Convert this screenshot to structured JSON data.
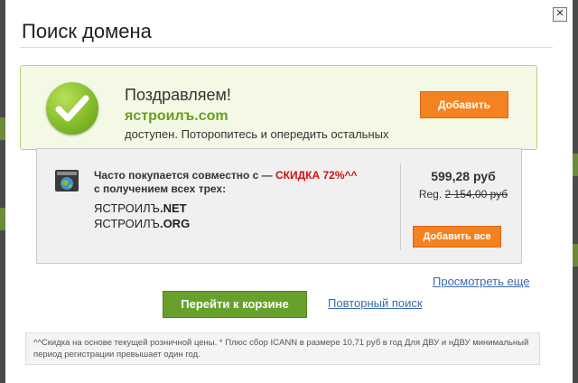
{
  "dialog": {
    "title": "Поиск домена",
    "close_icon": "close-icon"
  },
  "success": {
    "icon": "checkmark-icon",
    "congrats": "Поздравляем!",
    "domain": "ястроилъ.com",
    "availability": "доступен. Поторопитесь и опередить остальных",
    "add_button": "Добавить"
  },
  "bundle": {
    "icon": "domain-globe-icon",
    "text_before": "Часто покупается совместно с  — ",
    "discount": "СКИДКА 72%^^",
    "text_after": "  с получением всех трех:",
    "domains": [
      {
        "name": "ЯСТРОИЛЪ",
        "tld": ".NET"
      },
      {
        "name": "ЯСТРОИЛЪ",
        "tld": ".ORG"
      }
    ],
    "price": "599,28 руб",
    "reg_label": "Reg.",
    "reg_price": "2 154,00 руб",
    "add_all_button": "Добавить все"
  },
  "actions": {
    "view_more": "Просмотреть еще",
    "go_to_cart": "Перейти к корзине",
    "repeat_search": "Повторный поиск"
  },
  "footnote": "^^Скидка на основе текущей розничной цены. * Плюс сбор ICANN в размере 10,71 руб в год Для ДВУ и нДВУ минимальный период регистрации превышает один год.",
  "colors": {
    "accent_orange": "#f58220",
    "accent_green": "#67a12b",
    "domain_green": "#68a01f",
    "discount_red": "#cc1111",
    "link_blue": "#3b6ab0"
  }
}
